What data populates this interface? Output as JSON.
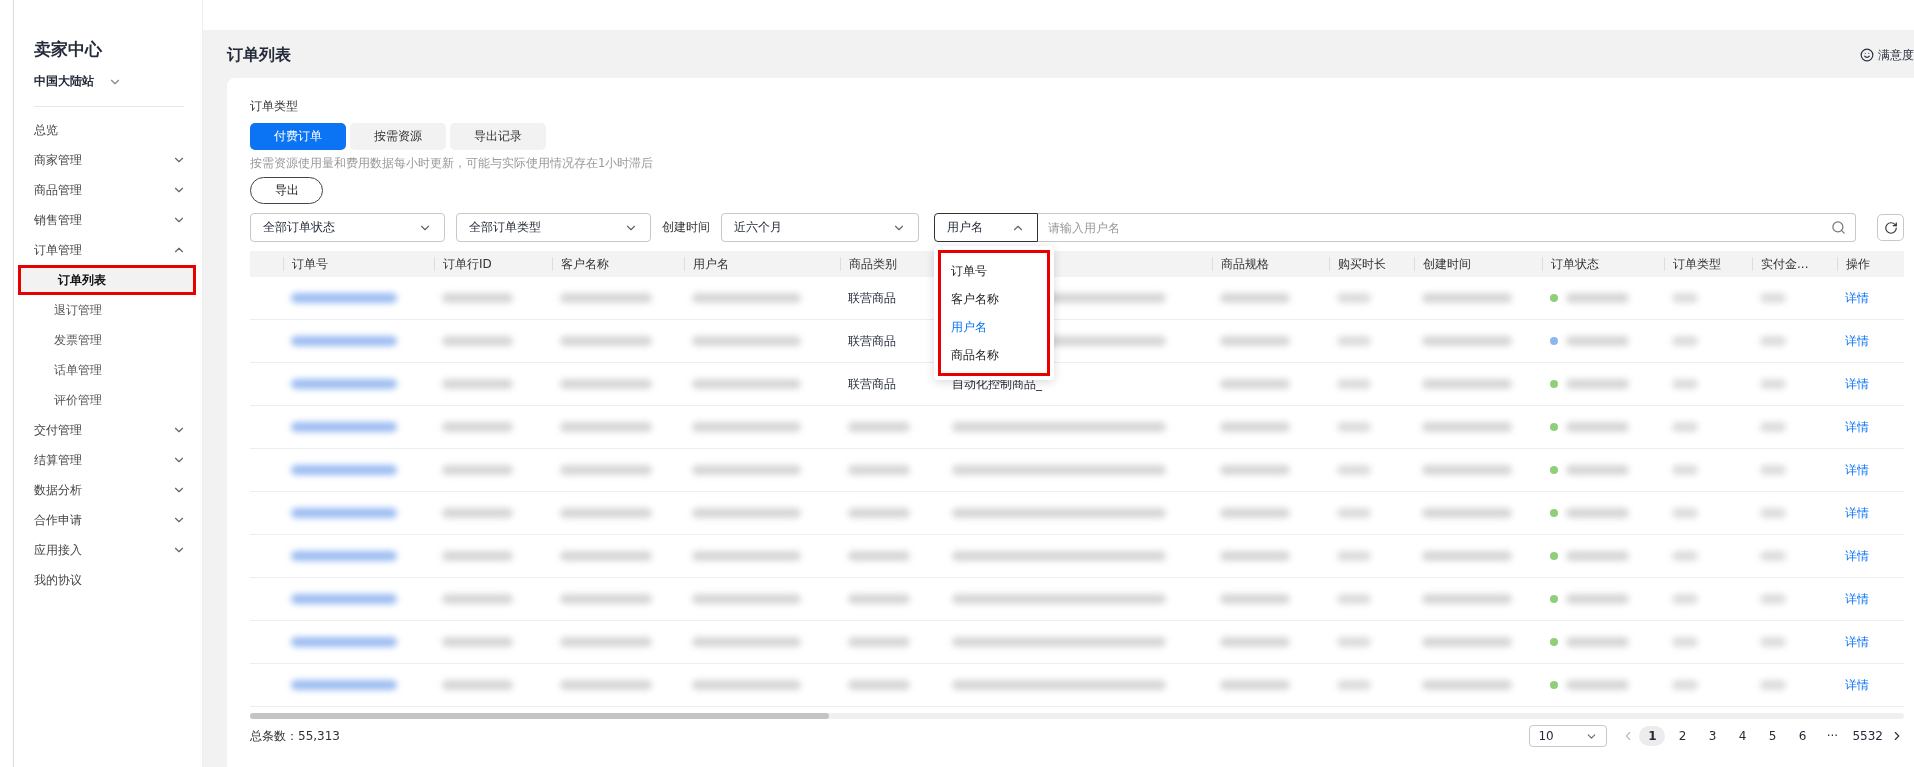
{
  "sidebar": {
    "brand": "卖家中心",
    "region": "中国大陆站",
    "items": [
      {
        "kind": "link",
        "label": "总览"
      },
      {
        "kind": "group",
        "label": "商家管理",
        "expanded": false
      },
      {
        "kind": "group",
        "label": "商品管理",
        "expanded": false
      },
      {
        "kind": "group",
        "label": "销售管理",
        "expanded": false
      },
      {
        "kind": "group",
        "label": "订单管理",
        "expanded": true,
        "children": [
          {
            "label": "订单列表",
            "selected": true,
            "highlighted": true
          },
          {
            "label": "退订管理",
            "selected": false,
            "highlighted": false
          },
          {
            "label": "发票管理",
            "selected": false,
            "highlighted": false
          },
          {
            "label": "话单管理",
            "selected": false,
            "highlighted": false
          },
          {
            "label": "评价管理",
            "selected": false,
            "highlighted": false
          }
        ]
      },
      {
        "kind": "group",
        "label": "交付管理",
        "expanded": false
      },
      {
        "kind": "group",
        "label": "结算管理",
        "expanded": false
      },
      {
        "kind": "group",
        "label": "数据分析",
        "expanded": false
      },
      {
        "kind": "group",
        "label": "合作申请",
        "expanded": false
      },
      {
        "kind": "group",
        "label": "应用接入",
        "expanded": false
      },
      {
        "kind": "link",
        "label": "我的协议"
      }
    ]
  },
  "page": {
    "title": "订单列表",
    "feedback": "满意度"
  },
  "section_label": "订单类型",
  "tabs": [
    {
      "label": "付费订单",
      "selected": true
    },
    {
      "label": "按需资源",
      "selected": false
    },
    {
      "label": "导出记录",
      "selected": false
    }
  ],
  "notice": "按需资源使用量和费用数据每小时更新，可能与实际使用情况存在1小时滞后",
  "export_button": "导出",
  "filters": {
    "status": "全部订单状态",
    "type": "全部订单类型",
    "date_label": "创建时间",
    "date": "近六个月"
  },
  "search": {
    "field": "用户名",
    "expanded": true,
    "placeholder": "请输入用户名",
    "options": [
      {
        "label": "订单号",
        "selected": false
      },
      {
        "label": "客户名称",
        "selected": false
      },
      {
        "label": "用户名",
        "selected": true
      },
      {
        "label": "商品名称",
        "selected": false
      }
    ],
    "highlighted": true
  },
  "table": {
    "columns": [
      "",
      "订单号",
      "订单行ID",
      "客户名称",
      "用户名",
      "商品类别",
      "",
      "商品规格",
      "购买时长",
      "创建时间",
      "订单状态",
      "订单类型",
      "实付金...",
      "操作"
    ],
    "rows": [
      {
        "category": "联营商品",
        "status": {
          "color": "#8fcf7a"
        },
        "action": "详情"
      },
      {
        "category": "联营商品",
        "status": {
          "color": "#8fb6ef"
        },
        "action": "详情"
      },
      {
        "category": "联营商品",
        "product": "自动化控制商品_",
        "status": {
          "color": "#8fcf7a"
        },
        "action": "详情"
      },
      {
        "status": {
          "color": "#8fcf7a"
        },
        "action": "详情"
      },
      {
        "status": {
          "color": "#8fcf7a"
        },
        "action": "详情"
      },
      {
        "status": {
          "color": "#8fcf7a"
        },
        "action": "详情"
      },
      {
        "status": {
          "color": "#8fcf7a"
        },
        "action": "详情"
      },
      {
        "status": {
          "color": "#8fcf7a"
        },
        "action": "详情"
      },
      {
        "status": {
          "color": "#8fcf7a"
        },
        "action": "详情"
      },
      {
        "status": {
          "color": "#8fcf7a"
        },
        "action": "详情"
      }
    ]
  },
  "pagination": {
    "total": "总条数：55,313",
    "page_size": "10",
    "pages": [
      {
        "label": "1",
        "selected": true
      },
      {
        "label": "2",
        "selected": false
      },
      {
        "label": "3",
        "selected": false
      },
      {
        "label": "4",
        "selected": false
      },
      {
        "label": "5",
        "selected": false
      },
      {
        "label": "6",
        "selected": false
      },
      {
        "label": "···",
        "selected": false
      },
      {
        "label": "5532",
        "selected": false
      }
    ]
  }
}
